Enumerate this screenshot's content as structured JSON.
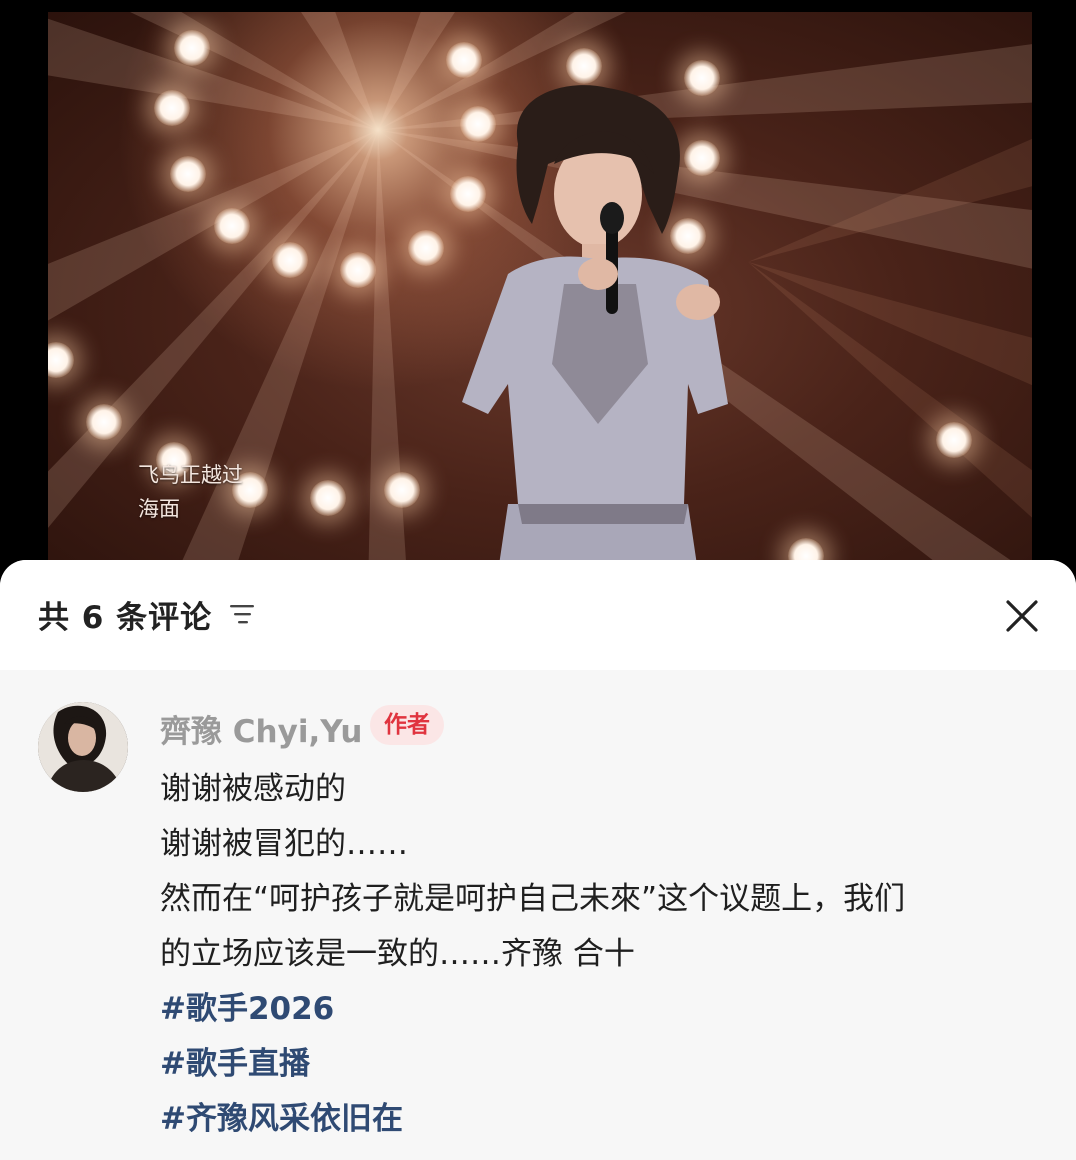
{
  "video": {
    "subtitle_line1": "飞鸟正越过",
    "subtitle_line2": "海面"
  },
  "comments_panel": {
    "title": "共 6 条评论",
    "filter_icon": "filter-icon",
    "close_icon": "close-icon"
  },
  "comment": {
    "username": "齊豫 Chyi,Yu",
    "badge": "作者",
    "lines": [
      "谢谢被感动的",
      "谢谢被冒犯的……",
      "然而在“呵护孩子就是呵护自己未來”这个议题上，我们",
      "的立场应该是一致的……齐豫 合十"
    ],
    "hashtags": [
      "#歌手2026",
      "#歌手直播",
      "#齐豫风采依旧在"
    ]
  },
  "colors": {
    "accent_badge_text": "#e0343f",
    "accent_badge_bg": "#fbe6e6",
    "hashtag": "#2f4a73",
    "username": "#9a9a9a"
  }
}
